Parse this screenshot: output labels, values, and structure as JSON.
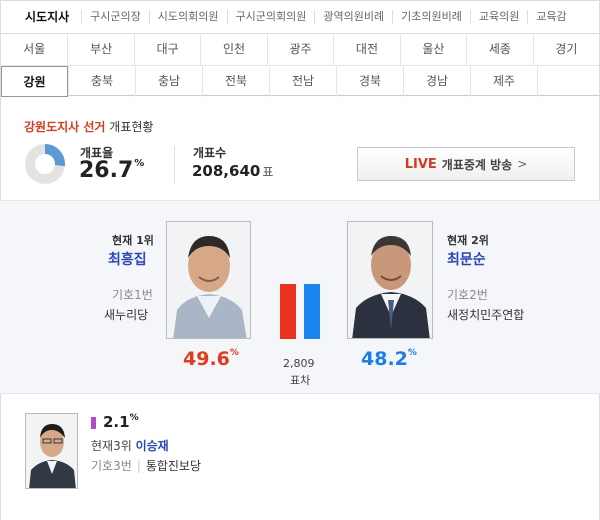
{
  "top_tabs": [
    "시도지사",
    "구시군의장",
    "시도의회의원",
    "구시군의회의원",
    "광역의원비례",
    "기초의원비례",
    "교육의원",
    "교육감"
  ],
  "regions_row1": [
    "서울",
    "부산",
    "대구",
    "인천",
    "광주",
    "대전",
    "울산",
    "세종",
    "경기"
  ],
  "regions_row2": [
    "강원",
    "충북",
    "충남",
    "전북",
    "전남",
    "경북",
    "경남",
    "제주"
  ],
  "title": {
    "highlight": "강원도지사 선거",
    "rest": "개표현황"
  },
  "turnout": {
    "label": "개표율",
    "value": "26.7",
    "pct": "%",
    "fraction": 0.267
  },
  "count": {
    "label": "개표수",
    "value": "208,640",
    "unit": "표"
  },
  "live": {
    "badge": "LIVE",
    "text": "개표중계 방송",
    "chevron": ">"
  },
  "candidates": {
    "first": {
      "rank": "현재 1위",
      "name": "최흥집",
      "number": "기호1번",
      "party": "새누리당",
      "pct": "49.6",
      "pct_sign": "%"
    },
    "second": {
      "rank": "현재 2위",
      "name": "최문순",
      "number": "기호2번",
      "party": "새정치민주연합",
      "pct": "48.2",
      "pct_sign": "%"
    },
    "third": {
      "rank": "현재3위",
      "name": "이승재",
      "number": "기호3번",
      "party": "통합진보당",
      "pct": "2.1",
      "pct_sign": "%"
    }
  },
  "gap": {
    "value": "2,809",
    "label": "표차"
  },
  "colors": {
    "red": "#e8331e",
    "blue": "#1b86ef",
    "purple": "#b14cc9",
    "donut": "#5b9bd5"
  }
}
